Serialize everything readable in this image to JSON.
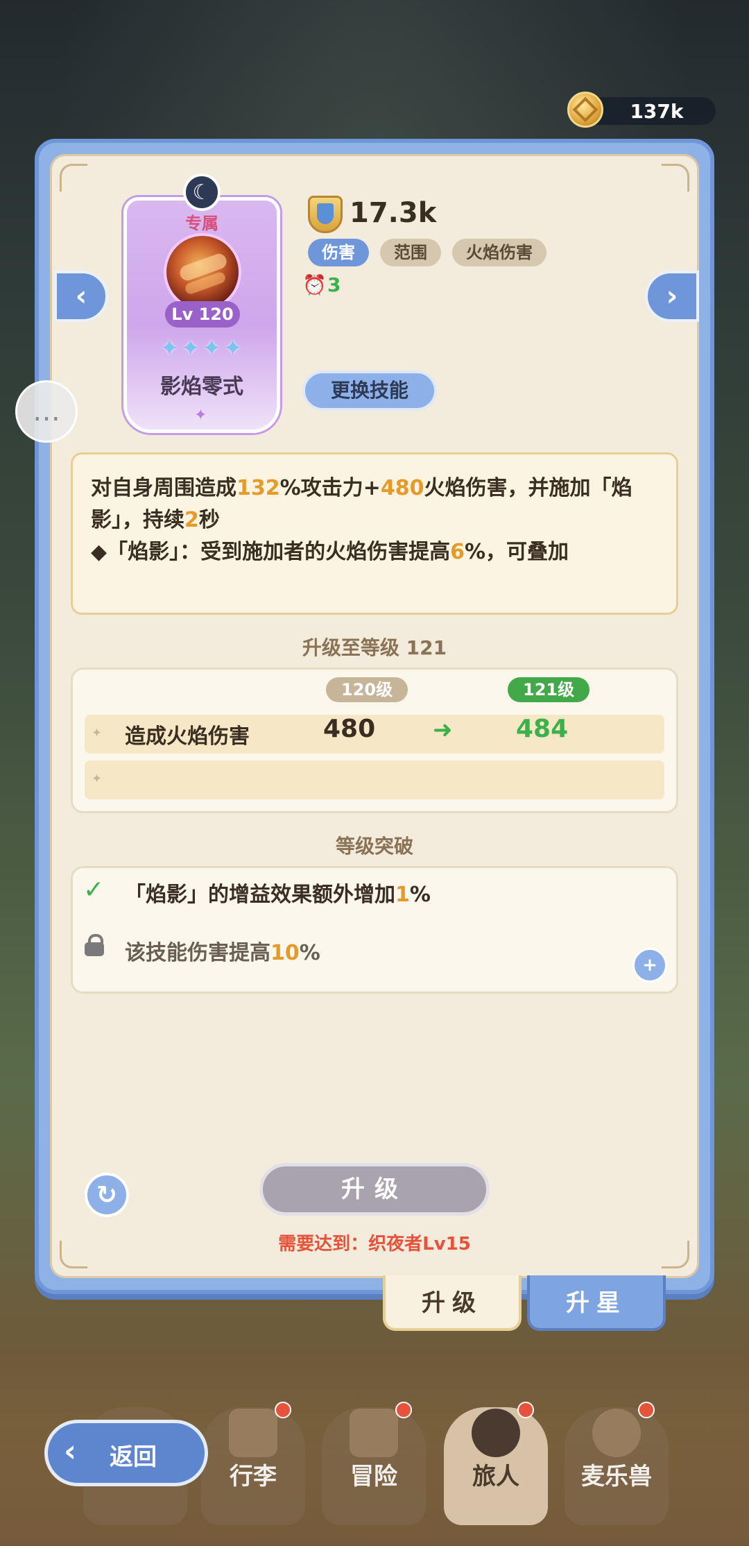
{
  "currency": {
    "amount": "137k",
    "icon": "coin-icon"
  },
  "skill": {
    "exclusive_label": "专属",
    "level": "Lv 120",
    "stars": "✦✦✦✦",
    "name": "影焰零式",
    "power": "17.3k",
    "tags": [
      "伤害",
      "范围",
      "火焰伤害"
    ],
    "cooldown": "3",
    "change_button": "更换技能"
  },
  "description": {
    "line1_parts": [
      "对自身周围造成",
      "132",
      "%攻击力+",
      "480",
      "火焰伤害，并施加「焰"
    ],
    "line2_parts": [
      "影」，持续",
      "2",
      "秒"
    ],
    "line3_parts": [
      "◆「焰影」：受到施加者的火焰伤害提高",
      "6",
      "%，可叠加"
    ]
  },
  "upgrade": {
    "title": "升级至等级 121",
    "current_level": "120级",
    "next_level": "121级",
    "stat_label": "造成火焰伤害",
    "stat_old": "480",
    "stat_new": "484"
  },
  "breakthrough": {
    "title": "等级突破",
    "item1_parts": [
      "「焰影」的增益效果额外增加",
      "1",
      "%"
    ],
    "item2_parts": [
      "该技能伤害提高",
      "10",
      "%"
    ]
  },
  "actions": {
    "upgrade_button": "升级",
    "requirement": "需要达到：织夜者Lv15"
  },
  "tabs": {
    "upgrade": "升级",
    "star": "升星"
  },
  "bottom_nav": {
    "back": "返回",
    "items": [
      "行李",
      "冒险",
      "旅人",
      "麦乐兽"
    ]
  },
  "colors": {
    "highlight": "#e69a2a",
    "positive": "#3bb14a",
    "warning": "#e5533a",
    "accent": "#6f96d8"
  }
}
